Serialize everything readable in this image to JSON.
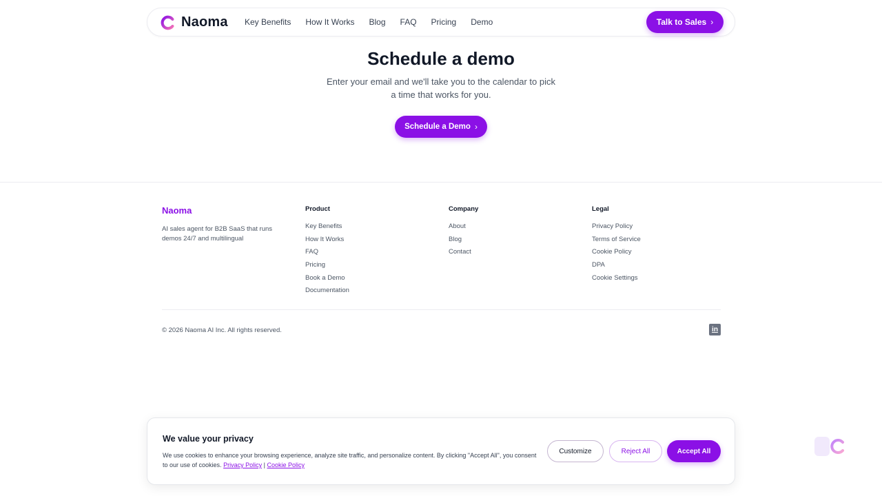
{
  "header": {
    "brand": "Naoma",
    "nav": [
      "Key Benefits",
      "How It Works",
      "Blog",
      "FAQ",
      "Pricing",
      "Demo"
    ],
    "cta": "Talk to Sales"
  },
  "hero": {
    "title": "Schedule a demo",
    "subtitle": "Enter your email and we'll take you to the calendar to pick a time that works for you.",
    "cta": "Schedule a Demo"
  },
  "footer": {
    "brand": "Naoma",
    "description": "AI sales agent for B2B SaaS that runs demos 24/7 and multilingual",
    "columns": [
      {
        "title": "Product",
        "links": [
          "Key Benefits",
          "How It Works",
          "FAQ",
          "Pricing",
          "Book a Demo",
          "Documentation"
        ]
      },
      {
        "title": "Company",
        "links": [
          "About",
          "Blog",
          "Contact"
        ]
      },
      {
        "title": "Legal",
        "links": [
          "Privacy Policy",
          "Terms of Service",
          "Cookie Policy",
          "DPA",
          "Cookie Settings"
        ]
      }
    ],
    "copyright": "© 2026 Naoma AI Inc. All rights reserved.",
    "social_icon": "linkedin-icon",
    "social_glyph": "in"
  },
  "cookie_banner": {
    "title": "We value your privacy",
    "text": "We use cookies to enhance your browsing experience, analyze site traffic, and personalize content. By clicking \"Accept All\", you consent to our use of cookies.",
    "privacy_link": "Privacy Policy",
    "separator": "|",
    "cookie_link": "Cookie Policy",
    "customize": "Customize",
    "reject": "Reject All",
    "accept": "Accept All"
  },
  "colors": {
    "accent": "#8b10e6",
    "text": "#111827",
    "muted": "#4b5563"
  }
}
